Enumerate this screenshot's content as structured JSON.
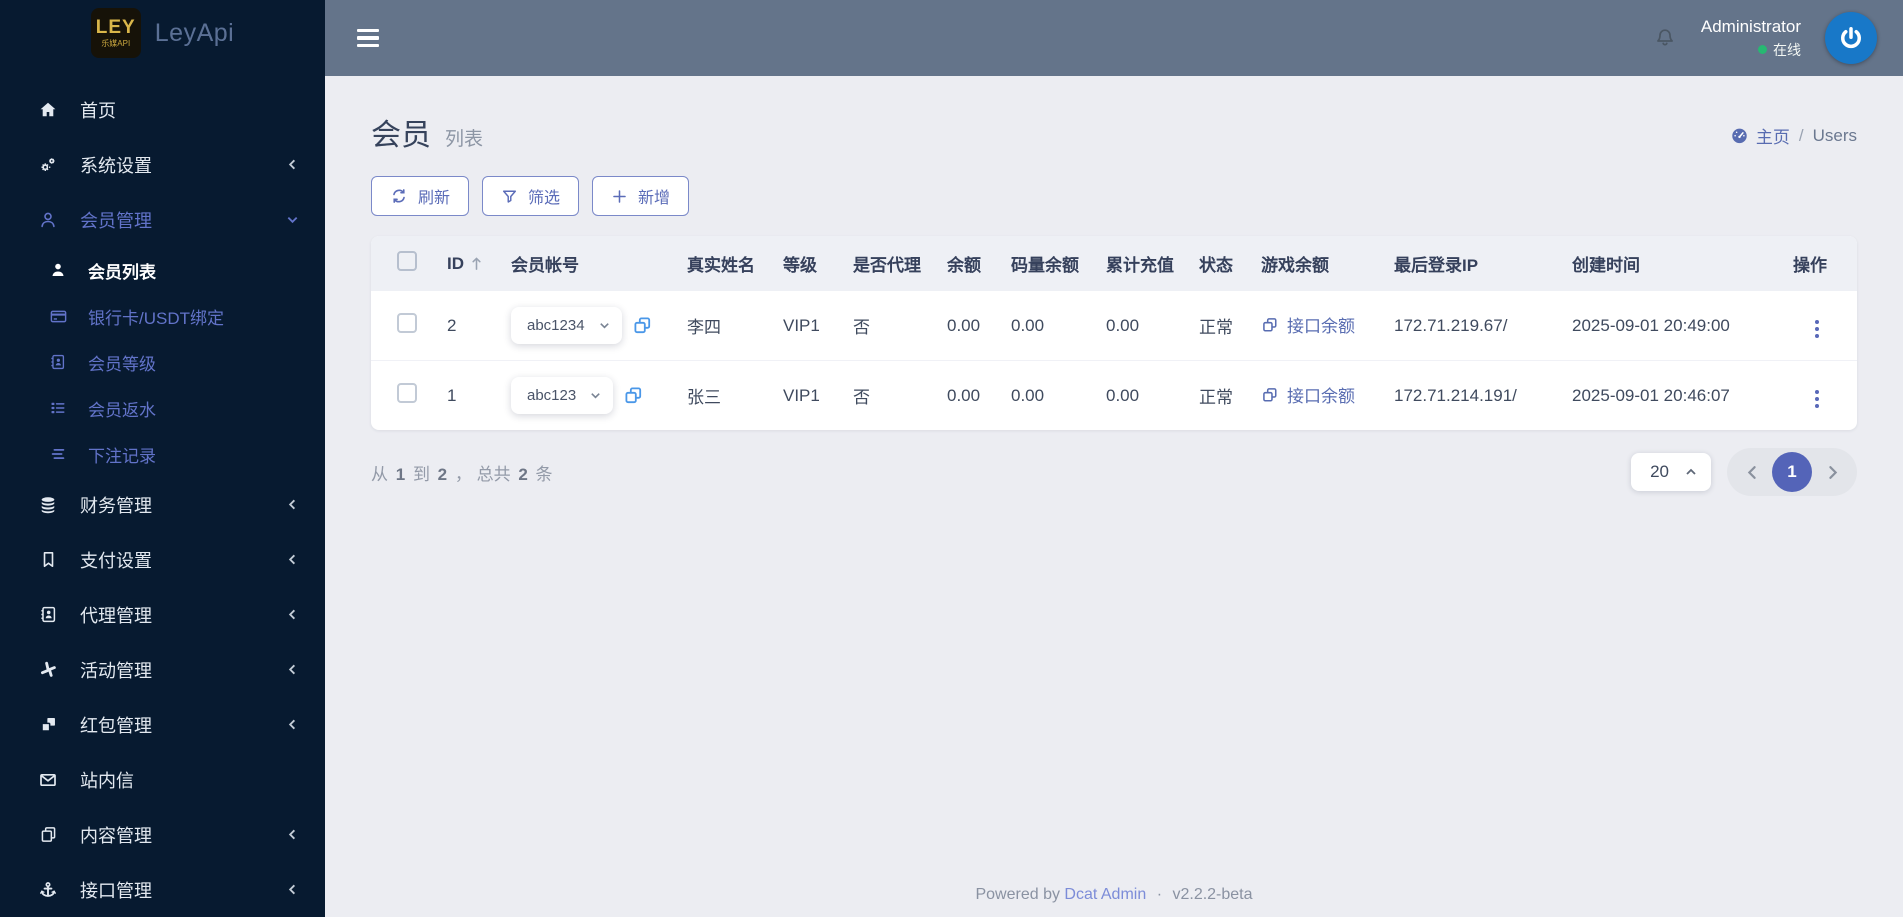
{
  "colors": {
    "accent_indigo": "#586cb1",
    "sidebar_bg": "#071a30",
    "topbar_bg": "#64748a",
    "content_bg": "#ecedf2",
    "copy_blue": "#4a97e8",
    "online_green": "#27b872",
    "avatar_blue": "#1878c8",
    "logo_gold": "#d9b64a"
  },
  "brand": {
    "logo_main": "LEY",
    "logo_sub": "乐媒API",
    "app_name": "LeyApi"
  },
  "topbar": {
    "user_name": "Administrator",
    "online_status": "在线"
  },
  "sidebar": {
    "items": [
      {
        "label": "首页",
        "icon": "home-icon"
      },
      {
        "label": "系统设置",
        "icon": "gears-icon",
        "chevron": "left"
      },
      {
        "label": "会员管理",
        "icon": "user-outline-icon",
        "chevron": "down",
        "state": "expanded"
      },
      {
        "label": "会员列表",
        "icon": "user-solid-icon",
        "state": "active",
        "sub": true
      },
      {
        "label": "银行卡/USDT绑定",
        "icon": "credit-card-icon",
        "sub": true
      },
      {
        "label": "会员等级",
        "icon": "address-book-icon",
        "sub": true
      },
      {
        "label": "会员返水",
        "icon": "list-icon",
        "sub": true
      },
      {
        "label": "下注记录",
        "icon": "stream-icon",
        "sub": true
      },
      {
        "label": "财务管理",
        "icon": "database-icon",
        "chevron": "left"
      },
      {
        "label": "支付设置",
        "icon": "bookmark-icon",
        "chevron": "left"
      },
      {
        "label": "代理管理",
        "icon": "id-card-icon",
        "chevron": "left"
      },
      {
        "label": "活动管理",
        "icon": "burst-icon",
        "chevron": "left"
      },
      {
        "label": "红包管理",
        "icon": "boxes-icon",
        "chevron": "left"
      },
      {
        "label": "站内信",
        "icon": "envelope-icon"
      },
      {
        "label": "内容管理",
        "icon": "copy-icon",
        "chevron": "left"
      },
      {
        "label": "接口管理",
        "icon": "anchor-icon",
        "chevron": "left"
      }
    ]
  },
  "page": {
    "title": "会员",
    "subtitle": "列表",
    "breadcrumb": {
      "home": "主页",
      "separator": "/",
      "current": "Users"
    }
  },
  "toolbar": {
    "refresh_label": "刷新",
    "filter_label": "筛选",
    "create_label": "新增"
  },
  "table": {
    "headers": [
      "ID",
      "会员帐号",
      "真实姓名",
      "等级",
      "是否代理",
      "余额",
      "码量余额",
      "累计充值",
      "状态",
      "游戏余额",
      "最后登录IP",
      "创建时间",
      "操作"
    ],
    "rows": [
      {
        "id": "2",
        "account": "abc1234",
        "real_name": "李四",
        "level": "VIP1",
        "is_agent": "否",
        "balance": "0.00",
        "code_balance": "0.00",
        "total_recharge": "0.00",
        "status": "正常",
        "game_balance_link": "接口余额",
        "last_login_ip": "172.71.219.67/",
        "created_at": "2025-09-01 20:49:00"
      },
      {
        "id": "1",
        "account": "abc123",
        "real_name": "张三",
        "level": "VIP1",
        "is_agent": "否",
        "balance": "0.00",
        "code_balance": "0.00",
        "total_recharge": "0.00",
        "status": "正常",
        "game_balance_link": "接口余额",
        "last_login_ip": "172.71.214.191/",
        "created_at": "2025-09-01 20:46:07"
      }
    ]
  },
  "pagination": {
    "summary": {
      "prefix": "从",
      "from": "1",
      "to_word": "到",
      "to": "2",
      "comma": "，",
      "total_word": "总共",
      "total": "2",
      "unit": "条"
    },
    "page_size": "20",
    "current_page": "1"
  },
  "footer": {
    "powered_by": "Powered by",
    "link": "Dcat Admin",
    "dot": "·",
    "version": "v2.2.2-beta"
  }
}
